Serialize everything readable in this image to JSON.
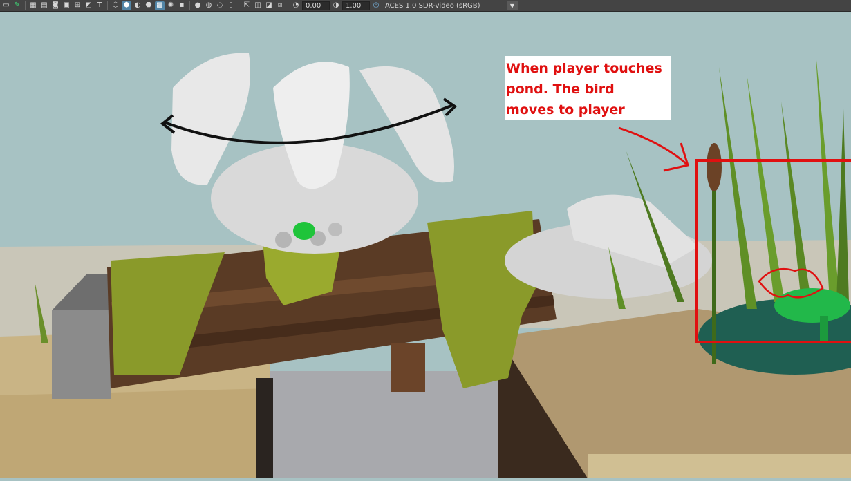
{
  "toolbar": {
    "exposure_value": "0.00",
    "gamma_value": "1.00",
    "color_space_label": "ACES 1.0 SDR-video (sRGB)",
    "icons": [
      "select-icon",
      "pencil-icon",
      "grid-icon",
      "film-gate-icon",
      "camera-icon",
      "resolution-gate-icon",
      "safe-area-icon",
      "image-plane-icon",
      "text-icon",
      "wireframe-icon",
      "smooth-shade-icon",
      "shaded-icon",
      "textured-icon",
      "xray-icon",
      "light-icon",
      "shadow-icon",
      "ambient-occlusion-icon",
      "motion-blur-icon",
      "anti-alias-icon",
      "isolate-icon",
      "xray-joints-icon",
      "backface-icon",
      "ui-layout-icon",
      "exposure-icon",
      "gamma-icon",
      "color-management-icon",
      "dropdown-icon"
    ]
  },
  "annotation": {
    "line1": "When player touches",
    "line2": "pond. The bird",
    "line3": "moves to player"
  },
  "colors": {
    "annotation_red": "#e01010",
    "sky": "#a7c2c3",
    "toolbar_bg": "#444444",
    "active_button": "#5285a6"
  }
}
